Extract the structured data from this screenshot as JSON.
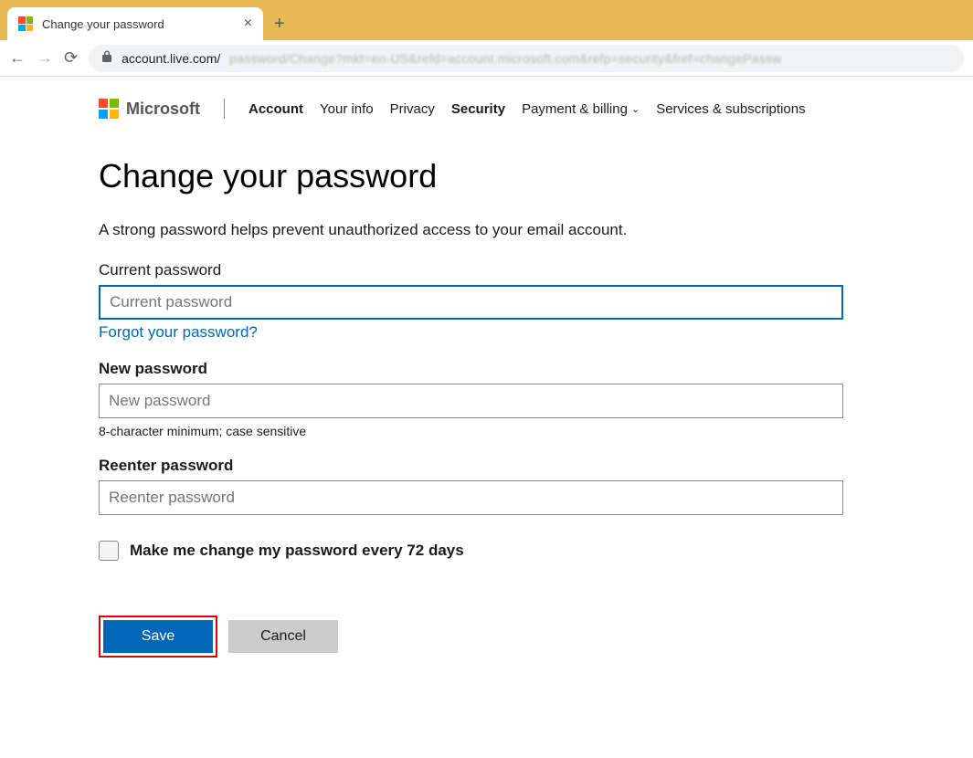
{
  "browser": {
    "tab_title": "Change your password",
    "url_visible": "account.live.com/",
    "url_blurred": "password/Change?mkt=en-US&refd=account.microsoft.com&refp=security&fref=changePassw"
  },
  "nav": {
    "brand": "Microsoft",
    "items": [
      {
        "label": "Account",
        "bold": true
      },
      {
        "label": "Your info",
        "bold": false
      },
      {
        "label": "Privacy",
        "bold": false
      },
      {
        "label": "Security",
        "bold": true
      },
      {
        "label": "Payment & billing",
        "bold": false,
        "dropdown": true
      },
      {
        "label": "Services & subscriptions",
        "bold": false
      }
    ]
  },
  "page": {
    "title": "Change your password",
    "subtitle": "A strong password helps prevent unauthorized access to your email account."
  },
  "fields": {
    "current": {
      "label": "Current password",
      "placeholder": "Current password",
      "forgot_link": "Forgot your password?"
    },
    "new": {
      "label": "New password",
      "placeholder": "New password",
      "hint": "8-character minimum; case sensitive"
    },
    "reenter": {
      "label": "Reenter password",
      "placeholder": "Reenter password"
    }
  },
  "checkbox": {
    "label": "Make me change my password every 72 days"
  },
  "buttons": {
    "save": "Save",
    "cancel": "Cancel"
  }
}
